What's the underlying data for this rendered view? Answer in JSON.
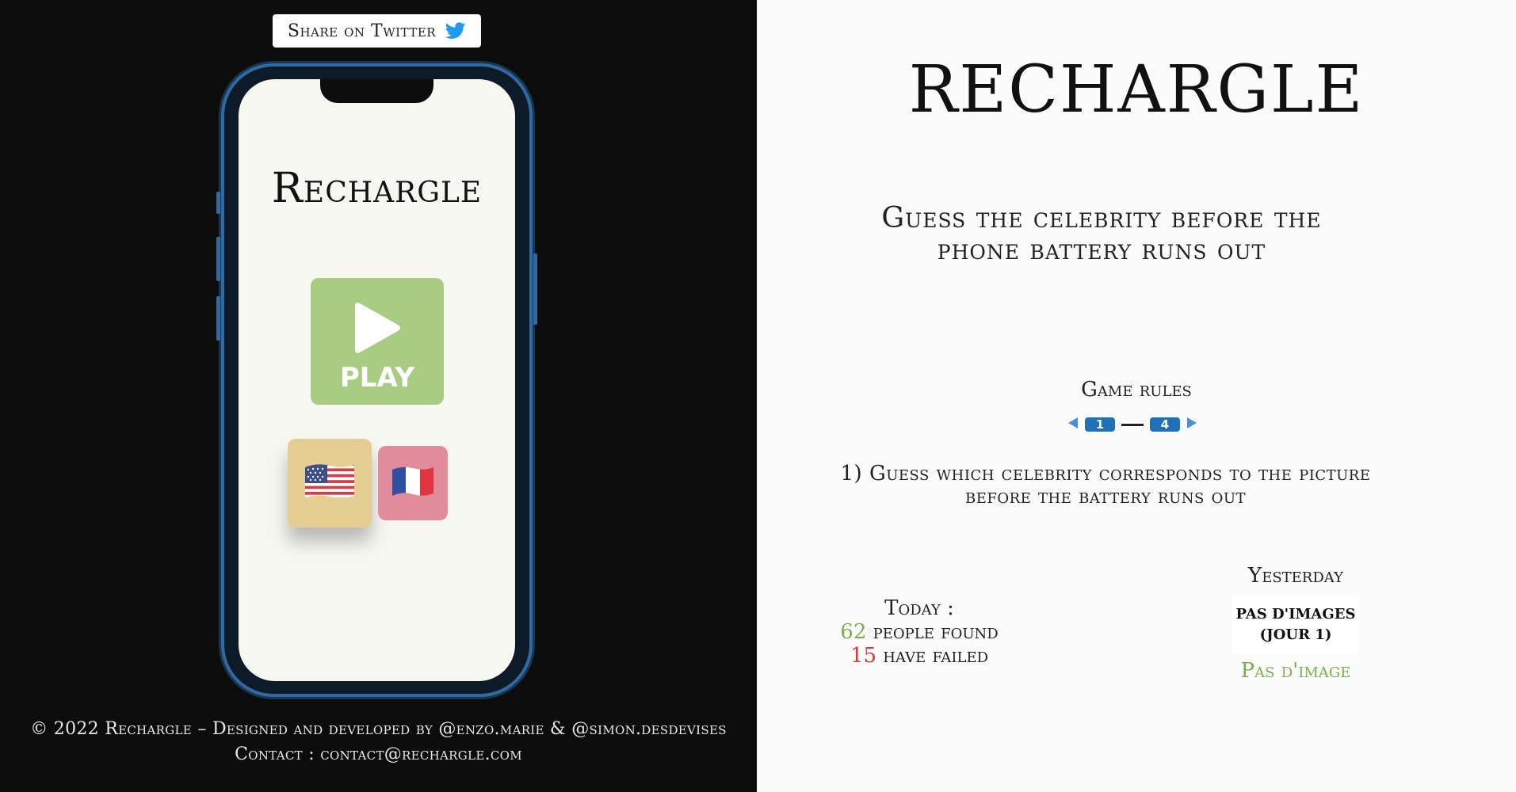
{
  "share": {
    "label": "Share on Twitter",
    "icon": "twitter-icon"
  },
  "phone": {
    "title": "Rechargle",
    "play_label": "PLAY",
    "flags": [
      {
        "name": "us-flag",
        "emoji": "🇺🇸"
      },
      {
        "name": "fr-flag",
        "emoji": "🇫🇷"
      }
    ]
  },
  "footer": {
    "line1": "© 2022 Rechargle – Designed and developed by @enzo.marie & @simon.desdevises",
    "line2": "Contact : contact@rechargle.com"
  },
  "main": {
    "title": "RECHARGLE",
    "subtitle": "Guess the celebrity before the phone battery runs out",
    "rules_title": "Game rules",
    "rules_page_current": "1",
    "rules_page_total": "4",
    "rule_text": "1) Guess which celebrity corresponds to the picture before the battery runs out"
  },
  "today": {
    "label": "Today :",
    "found_count": "62",
    "found_text": "people found",
    "failed_count": "15",
    "failed_text": "have failed"
  },
  "yesterday": {
    "label": "Yesterday",
    "box_line1": "PAS D'IMAGES",
    "box_line2": "(JOUR 1)",
    "caption": "Pas d'image"
  },
  "colors": {
    "left_bg": "#0c0c0c",
    "right_bg": "#fcfbfb",
    "play_green": "#a8cd82",
    "us_tile": "#e6cd92",
    "fr_tile": "#e08c9a",
    "accent_blue": "#1e70b8",
    "stat_green": "#7ab04a",
    "stat_red": "#d63a3a"
  }
}
